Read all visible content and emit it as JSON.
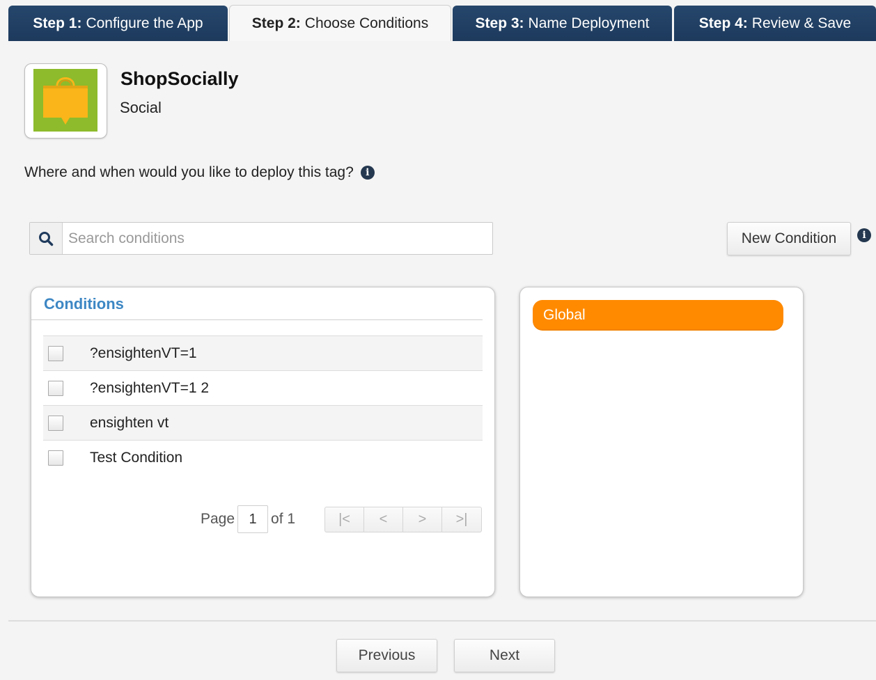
{
  "tabs": [
    {
      "step": "Step 1:",
      "label": "Configure the App",
      "active": false
    },
    {
      "step": "Step 2:",
      "label": "Choose Conditions",
      "active": true
    },
    {
      "step": "Step 3:",
      "label": "Name Deployment",
      "active": false
    },
    {
      "step": "Step 4:",
      "label": "Review & Save",
      "active": false
    }
  ],
  "app": {
    "name": "ShopSocially",
    "category": "Social",
    "icon": "shopping-bag-icon",
    "icon_bg_color": "#8dbb2c",
    "icon_fg_color": "#f9b519"
  },
  "question": "Where and when would you like to deploy this tag?",
  "search": {
    "placeholder": "Search conditions",
    "value": ""
  },
  "new_condition_label": "New Condition",
  "conditions_panel": {
    "title": "Conditions",
    "items": [
      {
        "label": "?ensightenVT=1",
        "checked": false
      },
      {
        "label": "?ensightenVT=1 2",
        "checked": false
      },
      {
        "label": "ensighten vt",
        "checked": false
      },
      {
        "label": "Test Condition",
        "checked": false
      }
    ],
    "pager": {
      "page_label": "Page",
      "page": "1",
      "of_label": "of 1",
      "first": "|<",
      "prev": "<",
      "next": ">",
      "last": ">|"
    }
  },
  "selected_panel": {
    "items": [
      "Global"
    ],
    "accent_color": "#ff8a00"
  },
  "footer": {
    "previous": "Previous",
    "next": "Next"
  }
}
